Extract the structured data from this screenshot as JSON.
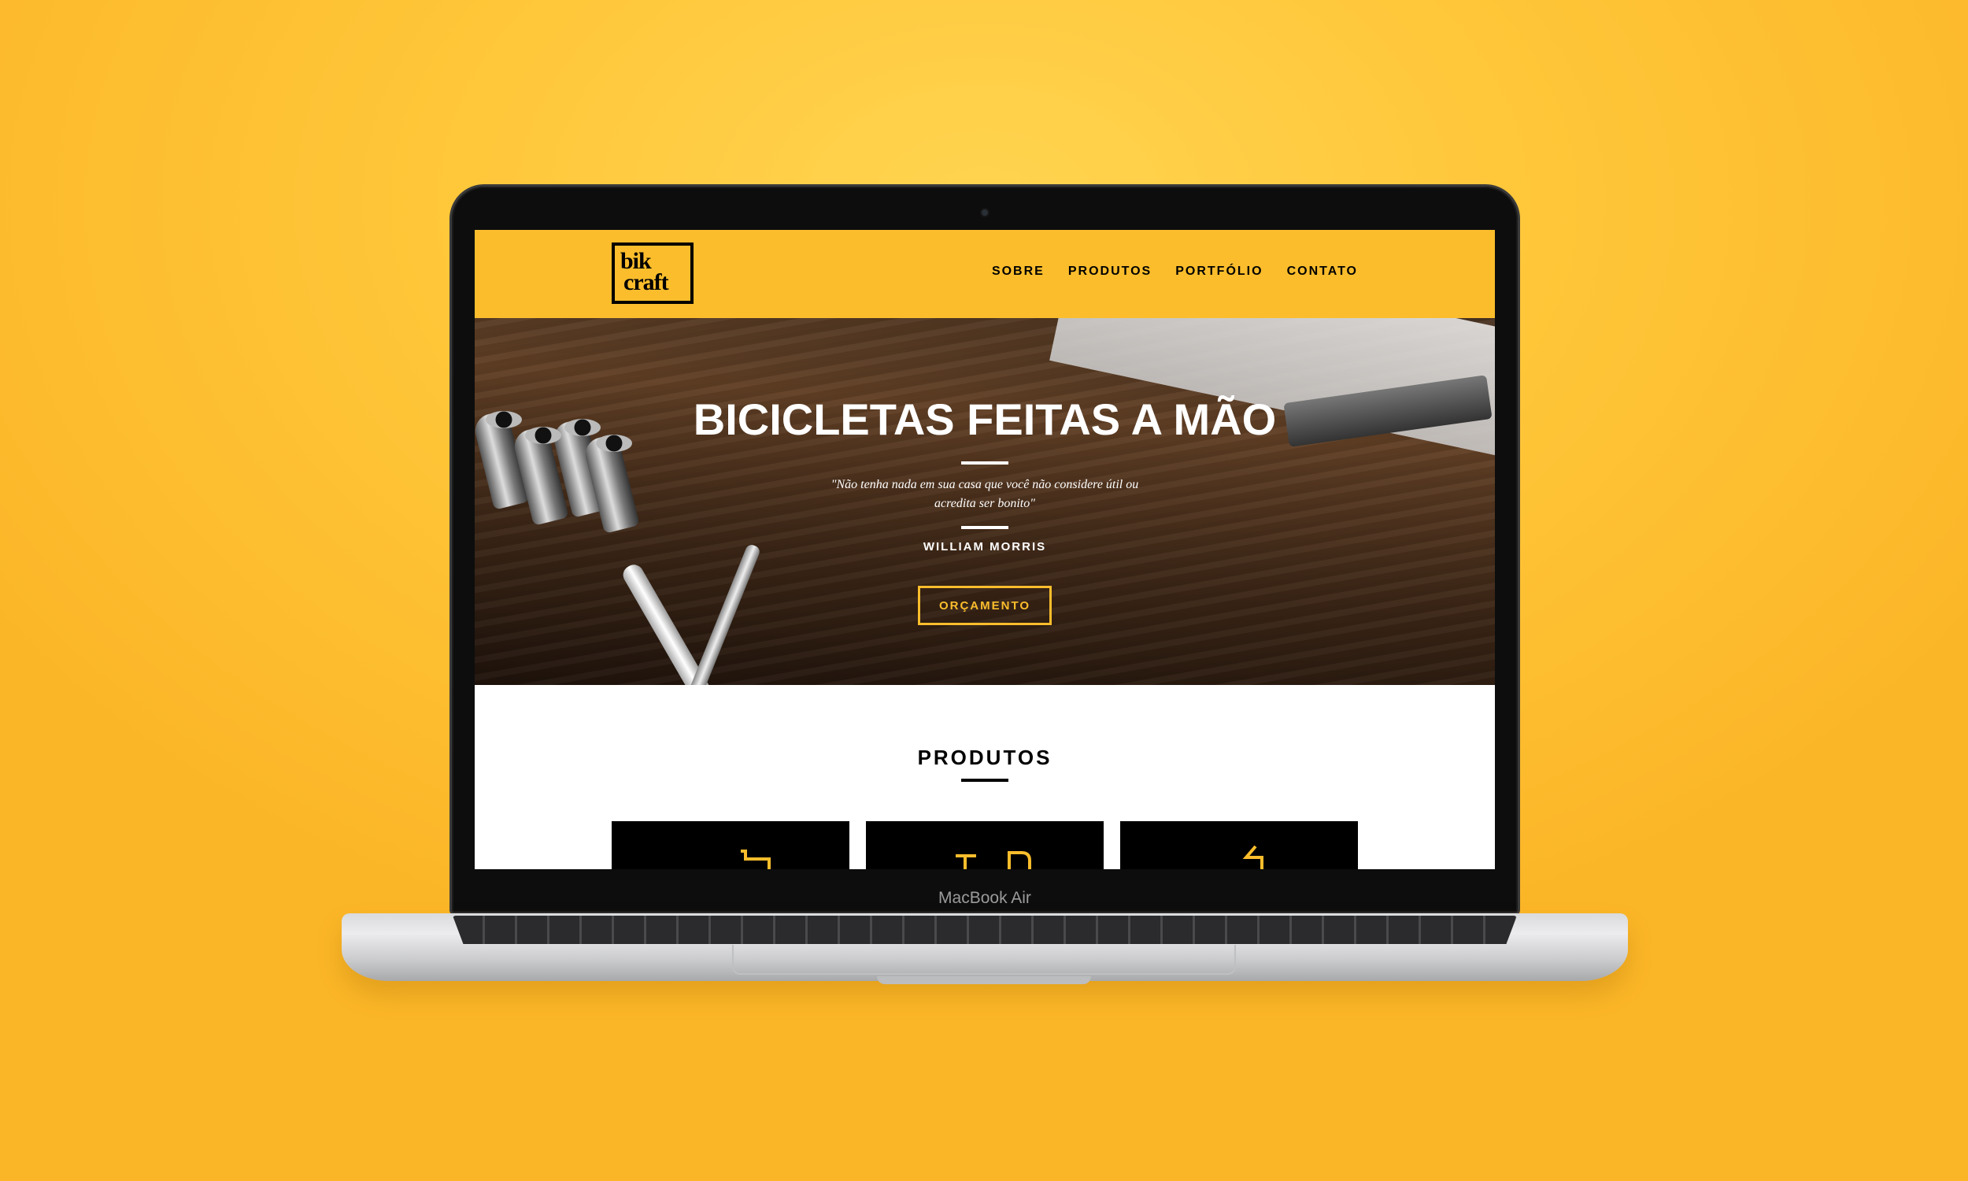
{
  "device": {
    "label": "MacBook Air"
  },
  "site": {
    "logo": {
      "line1": "bik",
      "line2": "craft"
    },
    "nav": [
      {
        "label": "SOBRE"
      },
      {
        "label": "PRODUTOS"
      },
      {
        "label": "PORTFÓLIO"
      },
      {
        "label": "CONTATO"
      }
    ],
    "hero": {
      "title": "BICICLETAS FEITAS A MÃO",
      "quote": "\"Não tenha nada em sua casa que você não considere útil ou acredita ser bonito\"",
      "author": "WILLIAM MORRIS",
      "cta_label": "ORÇAMENTO"
    },
    "products": {
      "title": "PRODUTOS",
      "cards": [
        {
          "icon": "bike-seat-icon"
        },
        {
          "icon": "bike-frame-icon"
        },
        {
          "icon": "bike-handlebar-icon"
        }
      ]
    },
    "colors": {
      "brand_yellow": "#fbbd2c",
      "dark": "#000000",
      "background": "#ffc73a"
    }
  }
}
